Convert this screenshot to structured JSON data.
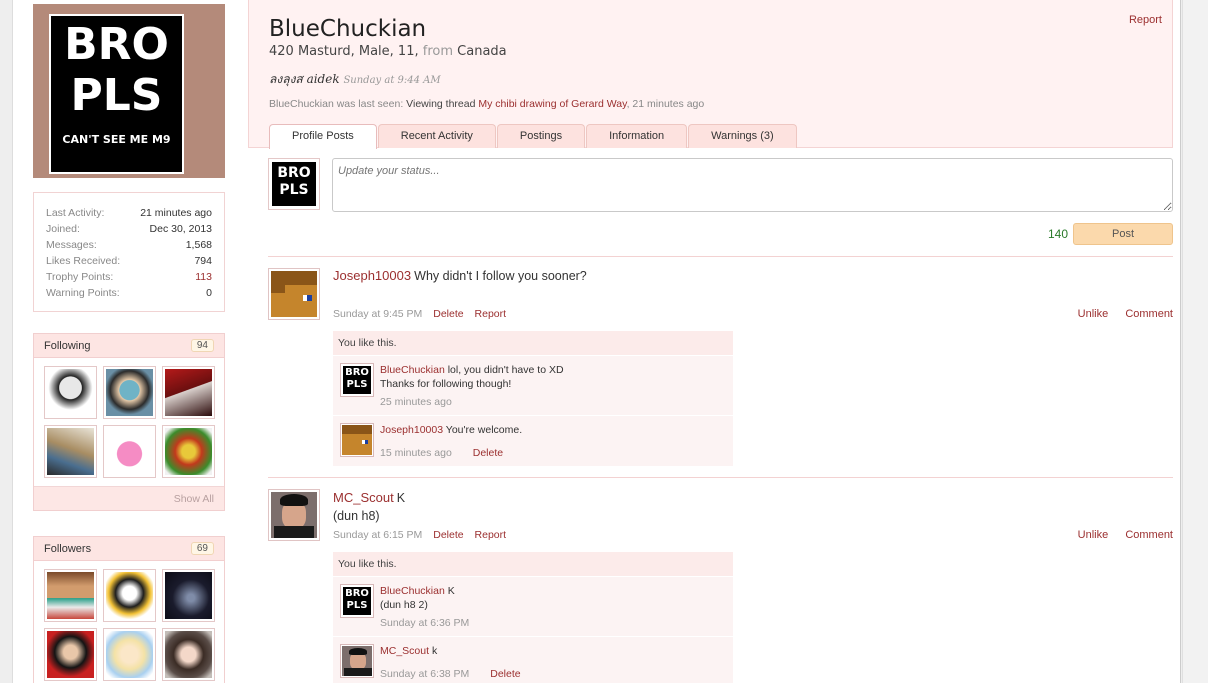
{
  "sidebar": {
    "avatar_text": [
      "BRO",
      "PLS",
      "CAN'T SEE ME M9"
    ],
    "stats": [
      {
        "label": "Last Activity:",
        "value": "21 minutes ago",
        "highlight": false
      },
      {
        "label": "Joined:",
        "value": "Dec 30, 2013",
        "highlight": false
      },
      {
        "label": "Messages:",
        "value": "1,568",
        "highlight": false
      },
      {
        "label": "Likes Received:",
        "value": "794",
        "highlight": false
      },
      {
        "label": "Trophy Points:",
        "value": "113",
        "highlight": true
      },
      {
        "label": "Warning Points:",
        "value": "0",
        "highlight": false
      }
    ],
    "following": {
      "title": "Following",
      "count": "94",
      "show_all": "Show All"
    },
    "followers": {
      "title": "Followers",
      "count": "69"
    }
  },
  "profile": {
    "username": "BlueChuckian",
    "blurb_main": "420 Masturd, Male, 11,",
    "blurb_from": "from",
    "blurb_location": "Canada",
    "signature": "ลงลุงส aidek",
    "signature_time": "Sunday at 9:44 AM",
    "lastseen_prefix": "BlueChuckian was last seen:",
    "lastseen_action": "Viewing thread",
    "lastseen_thread": "My chibi drawing of Gerard Way",
    "lastseen_time": ", 21 minutes ago",
    "report": "Report"
  },
  "tabs": [
    "Profile Posts",
    "Recent Activity",
    "Postings",
    "Information",
    "Warnings (3)"
  ],
  "status": {
    "placeholder": "Update your status...",
    "char_count": "140",
    "post_button": "Post"
  },
  "posts": [
    {
      "author": "Joseph10003",
      "text": "Why didn't I follow you sooner?",
      "text2": "",
      "time": "Sunday at 9:45 PM",
      "delete": "Delete",
      "report": "Report",
      "unlike": "Unlike",
      "comment": "Comment",
      "likes": "You like this.",
      "comments": [
        {
          "author": "BlueChuckian",
          "text": "lol, you didn't have to XD",
          "text2": "Thanks for following though!",
          "time": "25 minutes ago",
          "delete": ""
        },
        {
          "author": "Joseph10003",
          "text": "You're welcome.",
          "text2": "",
          "time": "15 minutes ago",
          "delete": "Delete"
        }
      ]
    },
    {
      "author": "MC_Scout",
      "text": "K",
      "text2": "(dun h8)",
      "time": "Sunday at 6:15 PM",
      "delete": "Delete",
      "report": "Report",
      "unlike": "Unlike",
      "comment": "Comment",
      "likes": "You like this.",
      "comments": [
        {
          "author": "BlueChuckian",
          "text": "K",
          "text2": "(dun h8 2)",
          "time": "Sunday at 6:36 PM",
          "delete": ""
        },
        {
          "author": "MC_Scout",
          "text": "k",
          "text2": "",
          "time": "Sunday at 6:38 PM",
          "delete": "Delete"
        }
      ]
    }
  ],
  "colors": {
    "link": "#9b2f2f",
    "header_bg": "#fff2f2",
    "tab_bg": "#fde2df",
    "post_button": "#fbd9ac",
    "char_count": "#2a7a2a"
  }
}
